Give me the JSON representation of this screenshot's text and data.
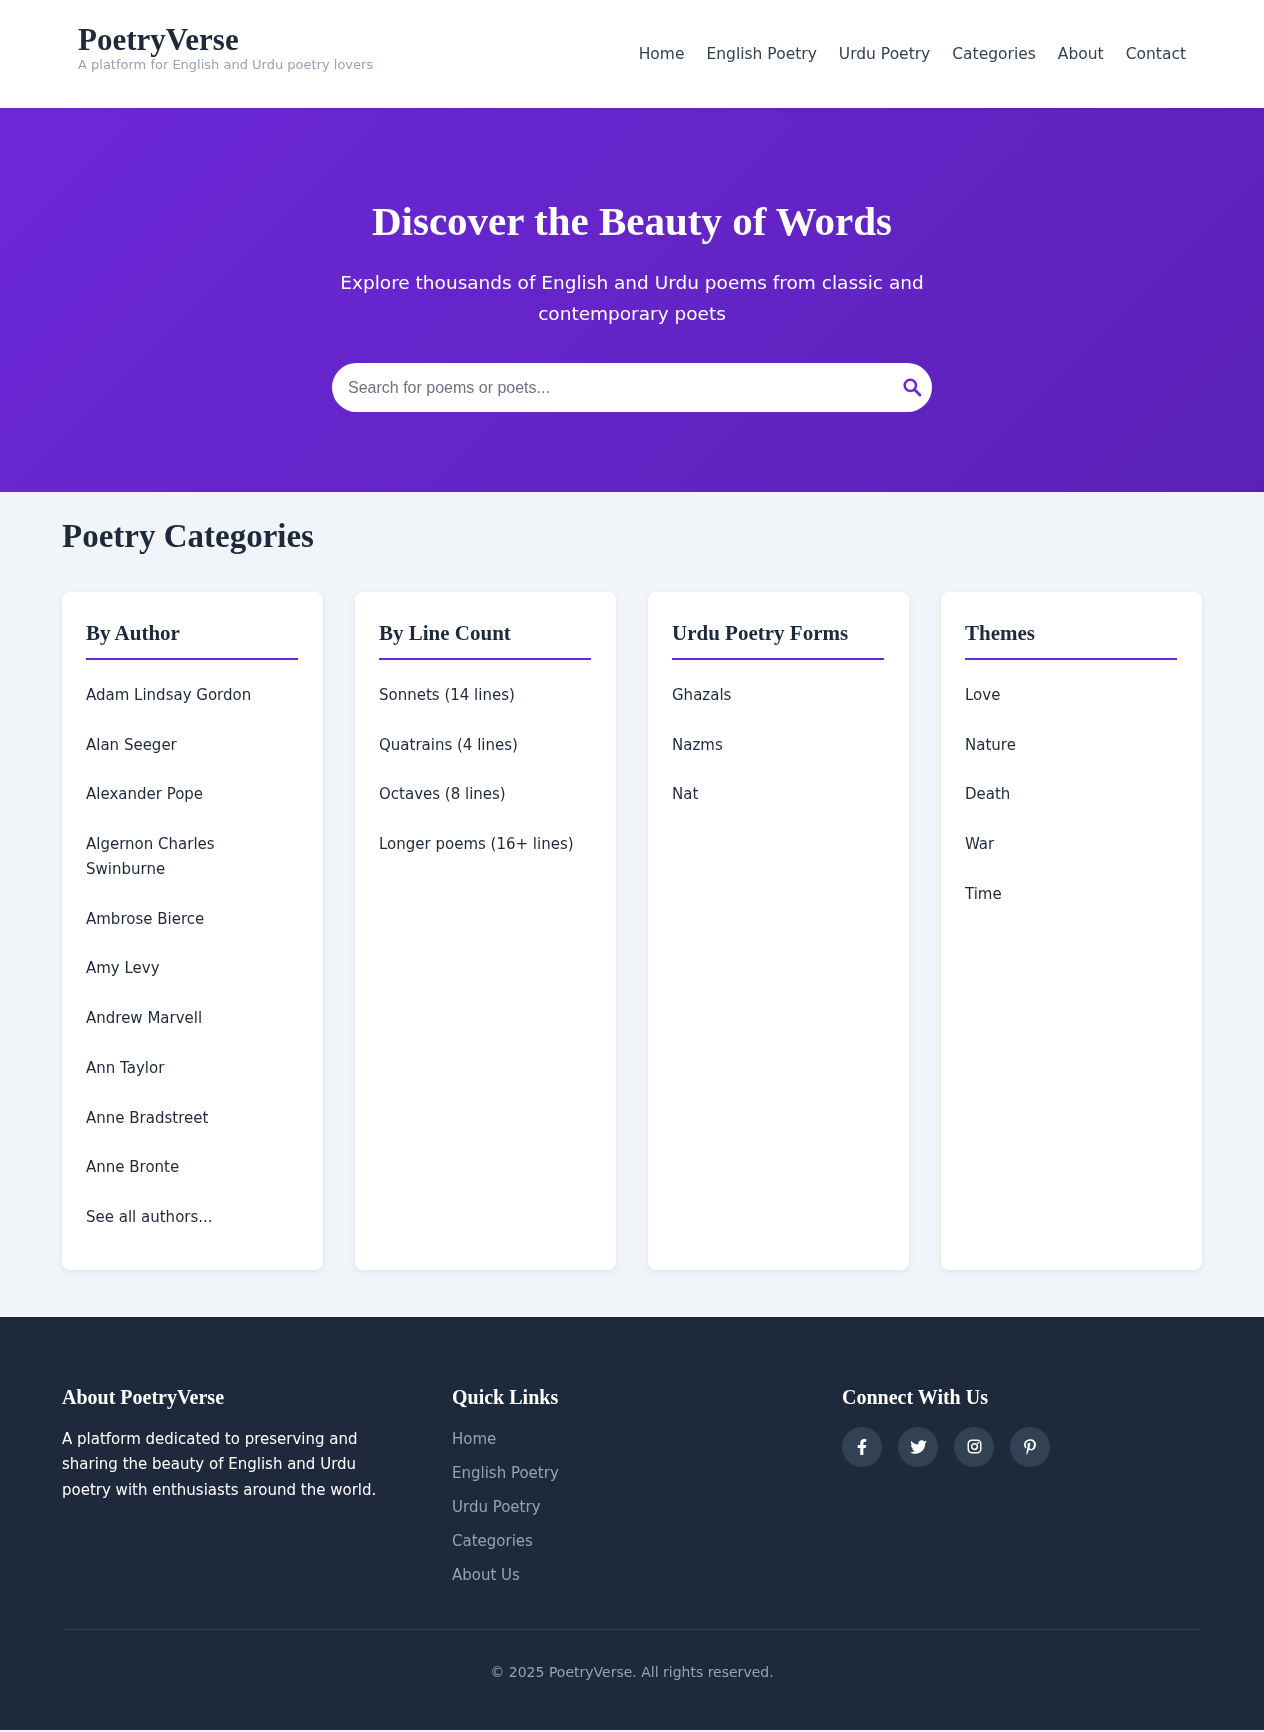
{
  "header": {
    "logo": "PoetryVerse",
    "tagline": "A platform for English and Urdu poetry lovers",
    "nav": [
      {
        "label": "Home"
      },
      {
        "label": "English Poetry"
      },
      {
        "label": "Urdu Poetry"
      },
      {
        "label": "Categories"
      },
      {
        "label": "About"
      },
      {
        "label": "Contact"
      }
    ]
  },
  "hero": {
    "title": "Discover the Beauty of Words",
    "subtitle": "Explore thousands of English and Urdu poems from classic and contemporary poets",
    "search": {
      "placeholder": "Search for poems or poets..."
    }
  },
  "categories": {
    "title": "Poetry Categories",
    "cards": [
      {
        "title": "By Author",
        "items": [
          "Adam Lindsay Gordon",
          "Alan Seeger",
          "Alexander Pope",
          "Algernon Charles Swinburne",
          "Ambrose Bierce",
          "Amy Levy",
          "Andrew Marvell",
          "Ann Taylor",
          "Anne Bradstreet",
          "Anne Bronte",
          "See all authors..."
        ]
      },
      {
        "title": "By Line Count",
        "items": [
          "Sonnets (14 lines)",
          "Quatrains (4 lines)",
          "Octaves (8 lines)",
          "Longer poems (16+ lines)"
        ]
      },
      {
        "title": "Urdu Poetry Forms",
        "items": [
          "Ghazals",
          "Nazms",
          "Nat"
        ]
      },
      {
        "title": "Themes",
        "items": [
          "Love",
          "Nature",
          "Death",
          "War",
          "Time"
        ]
      }
    ]
  },
  "footer": {
    "about": {
      "title": "About PoetryVerse",
      "text": "A platform dedicated to preserving and sharing the beauty of English and Urdu poetry with enthusiasts around the world."
    },
    "quick_links": {
      "title": "Quick Links",
      "links": [
        "Home",
        "English Poetry",
        "Urdu Poetry",
        "Categories",
        "About Us"
      ]
    },
    "connect": {
      "title": "Connect With Us",
      "icons": [
        {
          "kind": "f"
        },
        {
          "kind": "bird"
        },
        {
          "kind": "camera"
        },
        {
          "kind": "p"
        }
      ]
    },
    "copyright": "© 2025 PoetryVerse. All rights reserved."
  }
}
